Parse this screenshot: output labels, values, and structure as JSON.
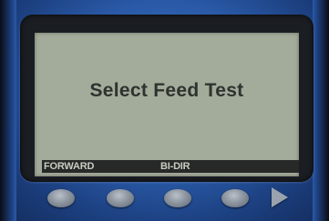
{
  "screen": {
    "message": "Select Feed Test",
    "softkeys": [
      "FORWARD",
      "BI-DIR"
    ]
  },
  "buttons": {
    "icons": [
      "softkey-1",
      "softkey-2",
      "softkey-3",
      "softkey-4",
      "right-arrow"
    ]
  },
  "colors": {
    "housing": "#2a5aa8",
    "lcd_background": "#a3ab9a",
    "lcd_text": "#2e332f",
    "softkey_bar": "#262927",
    "softkey_text": "#c7cdc1"
  }
}
